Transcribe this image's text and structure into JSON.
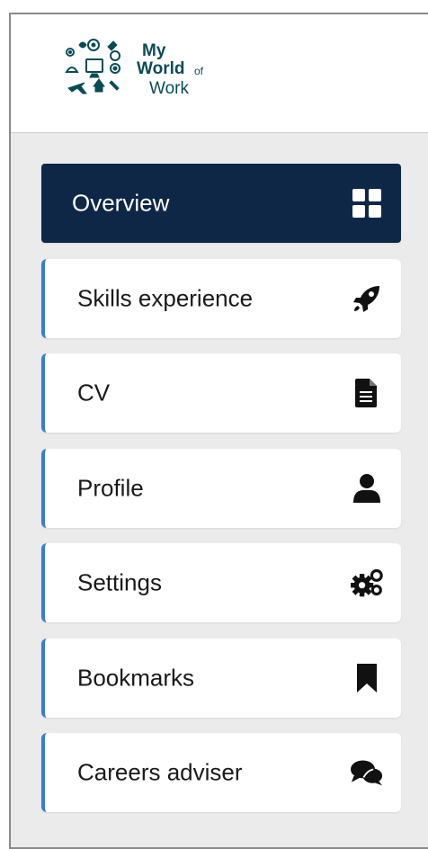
{
  "logo": {
    "line1": "My",
    "line2": "World",
    "line2_suffix": "of",
    "line3": "Work"
  },
  "menu": {
    "items": [
      {
        "label": "Overview",
        "icon": "grid-icon",
        "active": true
      },
      {
        "label": "Skills experience",
        "icon": "rocket-icon",
        "active": false
      },
      {
        "label": "CV",
        "icon": "document-icon",
        "active": false
      },
      {
        "label": "Profile",
        "icon": "user-icon",
        "active": false
      },
      {
        "label": "Settings",
        "icon": "gears-icon",
        "active": false
      },
      {
        "label": "Bookmarks",
        "icon": "bookmark-icon",
        "active": false
      },
      {
        "label": "Careers adviser",
        "icon": "chat-icon",
        "active": false
      }
    ]
  },
  "colors": {
    "active_bg": "#0e2747",
    "accent_border": "#3a7bd5",
    "logo_text": "#0b4b57",
    "page_bg": "#ebebeb"
  }
}
